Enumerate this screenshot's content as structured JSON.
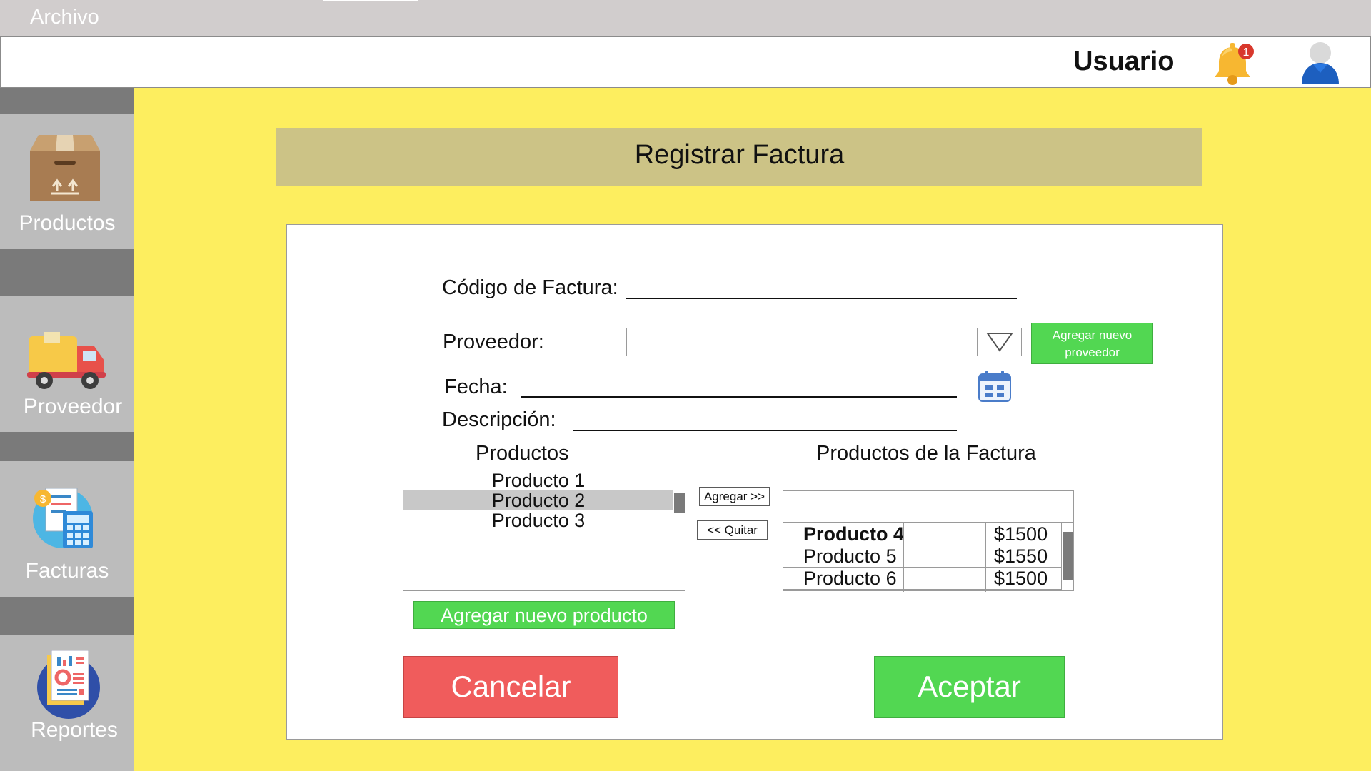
{
  "menubar": {
    "file_label": "Archivo"
  },
  "header": {
    "user_label": "Usuario",
    "notification_count": "1"
  },
  "sidebar": {
    "items": [
      {
        "label": "Productos",
        "icon": "box-icon"
      },
      {
        "label": "Proveedor",
        "icon": "truck-icon"
      },
      {
        "label": "Facturas",
        "icon": "invoice-calculator-icon"
      },
      {
        "label": "Reportes",
        "icon": "reports-icon"
      }
    ]
  },
  "main": {
    "title": "Registrar Factura",
    "form": {
      "codigo_label": "Código de Factura:",
      "proveedor_label": "Proveedor:",
      "proveedor_value": "",
      "add_supplier_button": "Agregar nuevo proveedor",
      "fecha_label": "Fecha:",
      "descripcion_label": "Descripción:"
    },
    "products": {
      "title": "Productos",
      "items": [
        "Producto 1",
        "Producto 2",
        "Producto 3"
      ],
      "selected": "Producto 2",
      "add_new_button": "Agregar nuevo producto"
    },
    "transfer": {
      "add_button": "Agregar >>",
      "remove_button": "<< Quitar"
    },
    "invoice_products": {
      "title": "Productos de la Factura",
      "search_value": "",
      "rows": [
        {
          "name": "Producto 4",
          "qty": "",
          "price": "$1500"
        },
        {
          "name": "Producto 5",
          "qty": "",
          "price": "$1550"
        },
        {
          "name": "Producto 6",
          "qty": "",
          "price": "$1500"
        }
      ]
    },
    "actions": {
      "cancel": "Cancelar",
      "accept": "Aceptar"
    }
  },
  "colors": {
    "background": "#fdee5f",
    "title_bar": "#ccc386",
    "green": "#52d752",
    "red": "#f05c5c",
    "sidebar": "#bcbcbc"
  }
}
